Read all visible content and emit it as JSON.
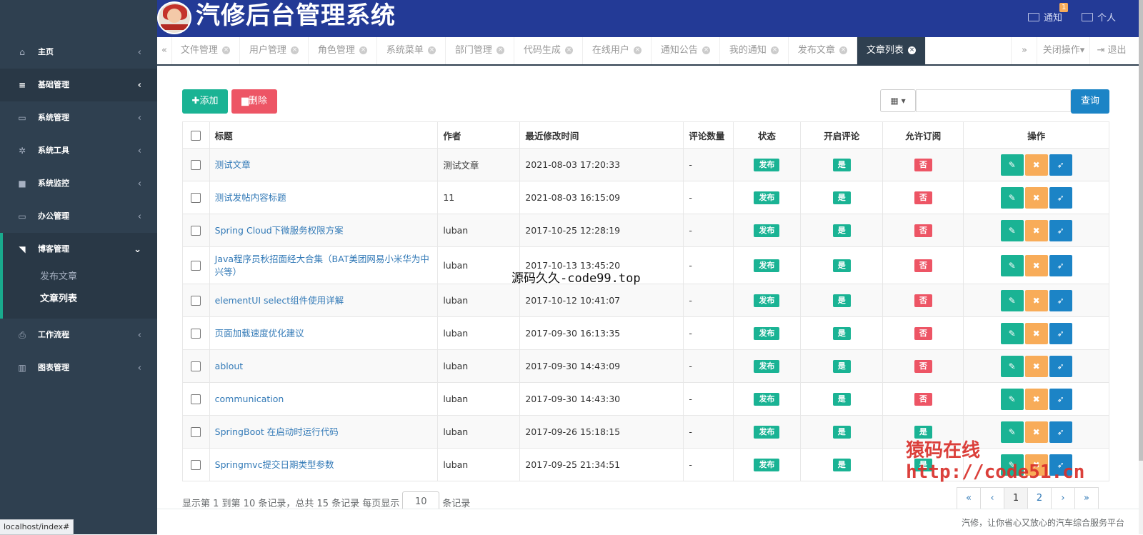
{
  "app": {
    "title": "汽修后台管理系统"
  },
  "header": {
    "notification_label": "通知",
    "notification_count": "1",
    "user_label": "个人"
  },
  "sidebar": {
    "items": [
      {
        "label": "主页",
        "icon": "home-icon"
      },
      {
        "label": "基础管理",
        "icon": "bars-icon"
      },
      {
        "label": "系统管理",
        "icon": "desktop-icon"
      },
      {
        "label": "系统工具",
        "icon": "gear-icon"
      },
      {
        "label": "系统监控",
        "icon": "video-camera-icon"
      },
      {
        "label": "办公管理",
        "icon": "laptop-icon"
      },
      {
        "label": "博客管理",
        "icon": "rss-icon"
      },
      {
        "label": "工作流程",
        "icon": "print-icon"
      },
      {
        "label": "图表管理",
        "icon": "bar-chart-icon"
      }
    ],
    "blog_sub": [
      "发布文章",
      "文章列表"
    ]
  },
  "tabs": [
    "文件管理",
    "用户管理",
    "角色管理",
    "系统菜单",
    "部门管理",
    "代码生成",
    "在线用户",
    "通知公告",
    "我的通知",
    "发布文章",
    "文章列表"
  ],
  "tab_actions": {
    "close_ops": "关闭操作",
    "logout": "退出"
  },
  "toolbar": {
    "add": "添加",
    "delete": "删除",
    "query": "查询",
    "search_value": ""
  },
  "table": {
    "headers": [
      "标题",
      "作者",
      "最近修改时间",
      "评论数量",
      "状态",
      "开启评论",
      "允许订阅",
      "操作"
    ],
    "rows": [
      {
        "title": "测试文章",
        "author": "测试文章",
        "time": "2021-08-03 17:20:33",
        "comments": "-",
        "status": "发布",
        "comment_on": "是",
        "subscribe": "否"
      },
      {
        "title": "测试发帖内容标题",
        "author": "11",
        "time": "2021-08-03 16:15:09",
        "comments": "-",
        "status": "发布",
        "comment_on": "是",
        "subscribe": "否"
      },
      {
        "title": "Spring Cloud下微服务权限方案",
        "author": "luban",
        "time": "2017-10-25 12:28:19",
        "comments": "-",
        "status": "发布",
        "comment_on": "是",
        "subscribe": "否"
      },
      {
        "title": "Java程序员秋招面经大合集（BAT美团网易小米华为中兴等）",
        "author": "luban",
        "time": "2017-10-13 13:45:20",
        "comments": "-",
        "status": "发布",
        "comment_on": "是",
        "subscribe": "否"
      },
      {
        "title": "elementUI select组件使用详解",
        "author": "luban",
        "time": "2017-10-12 10:41:07",
        "comments": "-",
        "status": "发布",
        "comment_on": "是",
        "subscribe": "否"
      },
      {
        "title": "页面加载速度优化建议",
        "author": "luban",
        "time": "2017-09-30 16:13:35",
        "comments": "-",
        "status": "发布",
        "comment_on": "是",
        "subscribe": "否"
      },
      {
        "title": "ablout",
        "author": "luban",
        "time": "2017-09-30 14:43:09",
        "comments": "-",
        "status": "发布",
        "comment_on": "是",
        "subscribe": "否"
      },
      {
        "title": "communication",
        "author": "luban",
        "time": "2017-09-30 14:43:30",
        "comments": "-",
        "status": "发布",
        "comment_on": "是",
        "subscribe": "否"
      },
      {
        "title": "SpringBoot 在启动时运行代码",
        "author": "luban",
        "time": "2017-09-26 15:18:15",
        "comments": "-",
        "status": "发布",
        "comment_on": "是",
        "subscribe": "是"
      },
      {
        "title": "Springmvc提交日期类型参数",
        "author": "luban",
        "time": "2017-09-25 21:34:51",
        "comments": "-",
        "status": "发布",
        "comment_on": "是",
        "subscribe": "是"
      }
    ]
  },
  "pagination": {
    "info_prefix": "显示第 1 到第 10 条记录，总共 15 条记录 每页显示",
    "page_size": "10",
    "info_suffix": "条记录",
    "first": "«",
    "prev": "‹",
    "pages": [
      "1",
      "2"
    ],
    "next": "›",
    "last": "»"
  },
  "footer": {
    "text": "汽修，让你省心又放心的汽车综合服务平台"
  },
  "status_url": "localhost/index#",
  "watermarks": {
    "center": "源码久久-code99.top",
    "corner_cn": "猿码在线",
    "corner_url": "http://code51.cn"
  },
  "colors": {
    "sidebar": "#2f4050",
    "header": "#233a96",
    "primary": "#1ab394",
    "danger": "#ed5565",
    "warning": "#f8ac59",
    "info": "#1c84c6"
  }
}
